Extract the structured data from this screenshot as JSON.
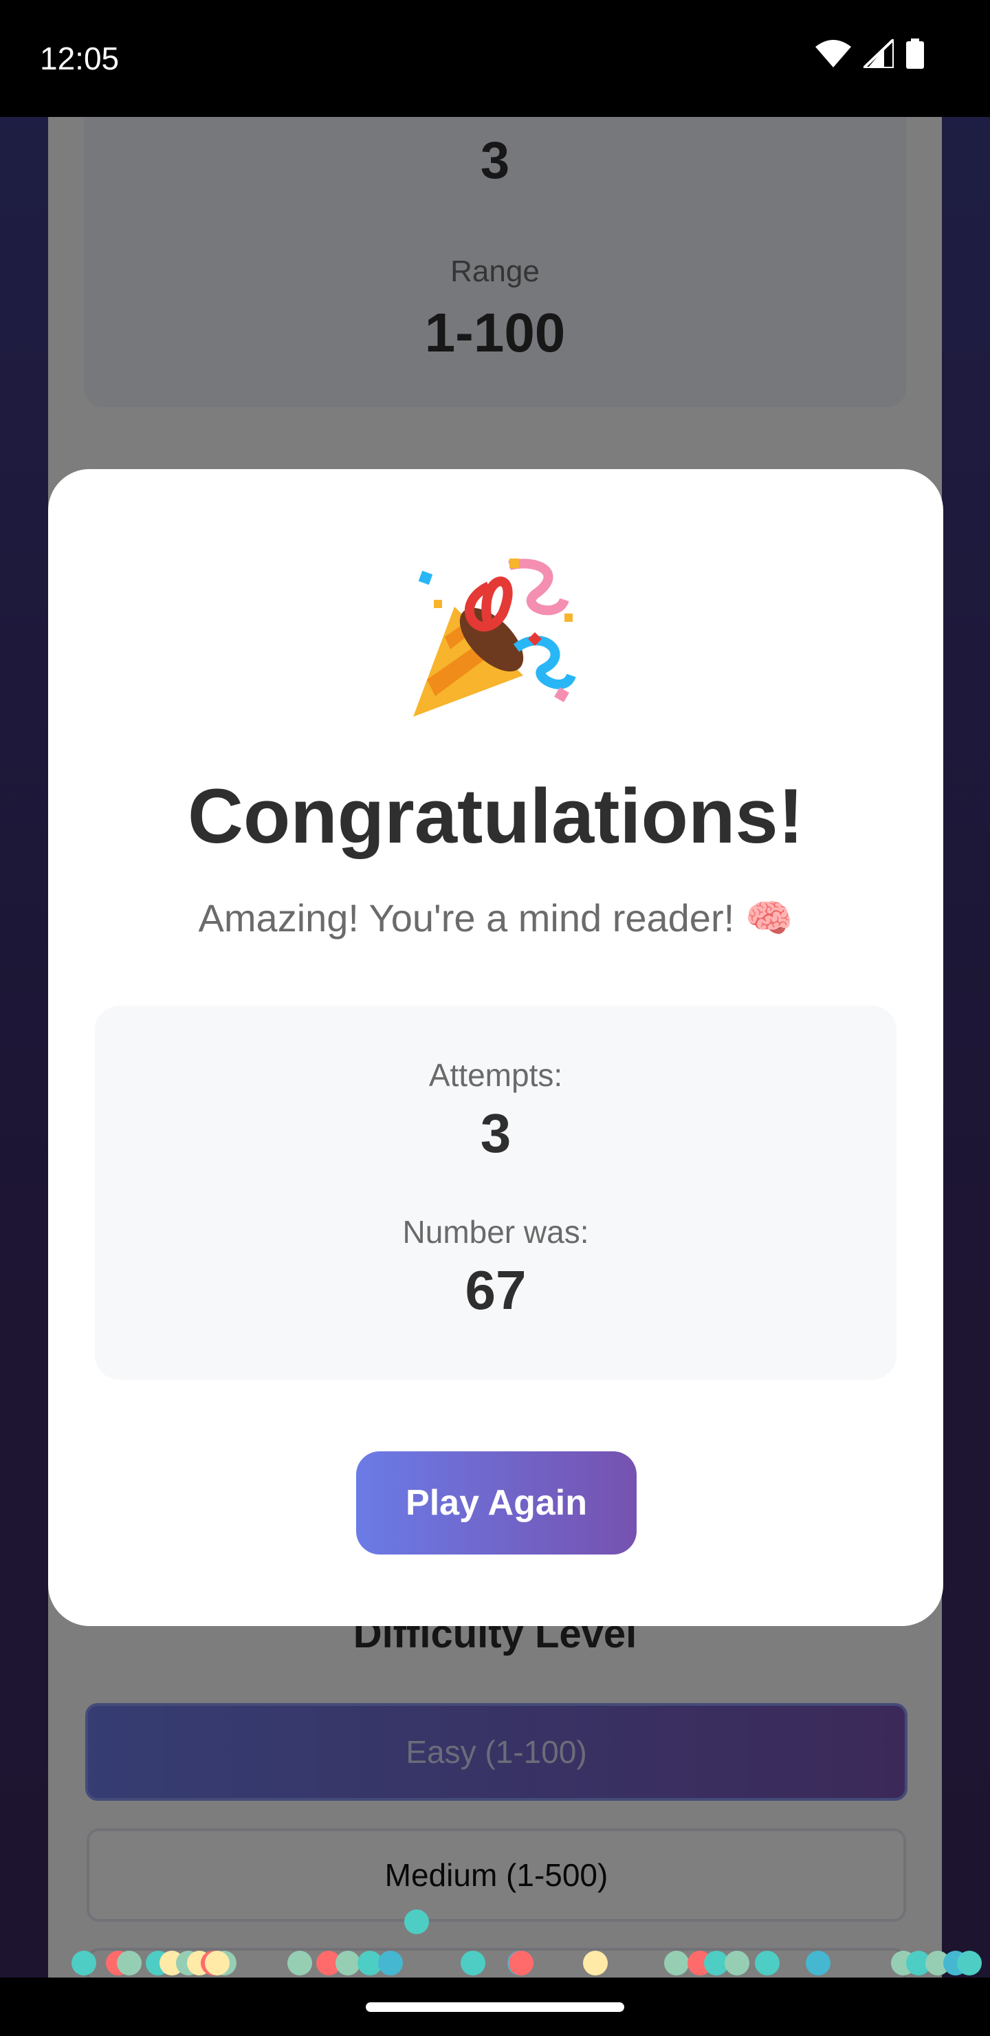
{
  "status_bar": {
    "time": "12:05"
  },
  "background": {
    "stat_top_value": "3",
    "range_label": "Range",
    "range_value": "1-100",
    "difficulty_title": "Difficulty Level",
    "difficulty_options": [
      "Easy (1-100)",
      "Medium (1-500)"
    ]
  },
  "modal": {
    "icon": "party-popper-icon",
    "title": "Congratulations!",
    "message": "Amazing! You're a mind reader! 🧠",
    "attempts_label": "Attempts:",
    "attempts_value": "3",
    "number_label": "Number was:",
    "number_value": "67",
    "play_again_label": "Play Again"
  },
  "colors": {
    "accent_start": "#6b7be6",
    "accent_end": "#7652b0",
    "confetti": [
      "#4ecdc4",
      "#ff6b6b",
      "#ffeaa7",
      "#96ceb4",
      "#45b7d1"
    ]
  }
}
